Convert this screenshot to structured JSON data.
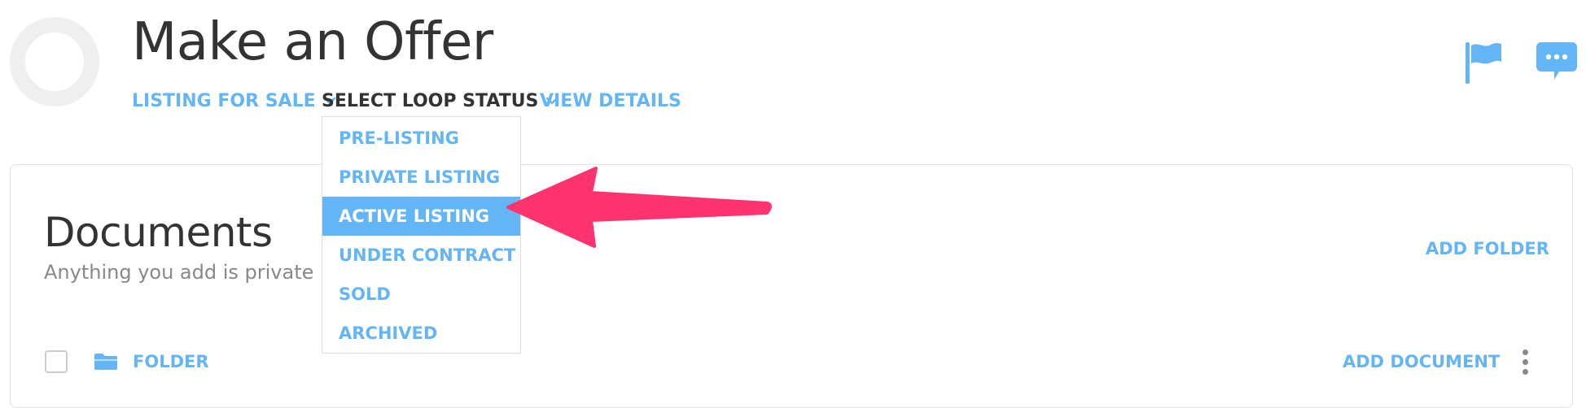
{
  "header": {
    "title": "Make an Offer",
    "nav": {
      "listing_type": "LISTING FOR SALE",
      "loop_status": "SELECT LOOP STATUS",
      "view_details": "VIEW DETAILS"
    },
    "icons": [
      "flag-icon",
      "chat-icon"
    ]
  },
  "status_dropdown": {
    "options": [
      "PRE-LISTING",
      "PRIVATE LISTING",
      "ACTIVE LISTING",
      "UNDER CONTRACT",
      "SOLD",
      "ARCHIVED"
    ],
    "highlighted": "ACTIVE LISTING"
  },
  "documents": {
    "title": "Documents",
    "subtitle": "Anything you add is private u",
    "add_folder": "ADD FOLDER",
    "row": {
      "folder_label": "FOLDER",
      "add_document": "ADD DOCUMENT"
    }
  },
  "colors": {
    "accent": "#64b5f6",
    "annotation_arrow": "#ff3370",
    "text_dark": "#333333"
  }
}
